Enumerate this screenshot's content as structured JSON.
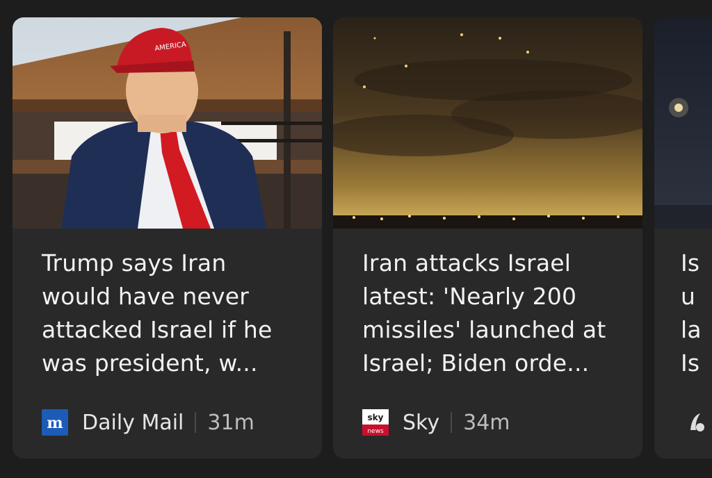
{
  "cards": [
    {
      "headline_lines": [
        "Trump says Iran",
        "would have never",
        "attacked Israel if he",
        "was president, w..."
      ],
      "source": "Daily Mail",
      "age": "31m",
      "logo_icon": "daily-mail-logo",
      "logo_color": "#1c5bb8"
    },
    {
      "headline_lines": [
        "Iran attacks Israel",
        "latest: 'Nearly 200",
        "missiles' launched at",
        "Israel; Biden orde..."
      ],
      "source": "Sky",
      "age": "34m",
      "logo_icon": "sky-news-logo",
      "logo_color": "#c8102e"
    },
    {
      "headline_lines": [
        "Is",
        "u",
        "la",
        "Is"
      ],
      "logo_icon": "source-logo"
    }
  ]
}
